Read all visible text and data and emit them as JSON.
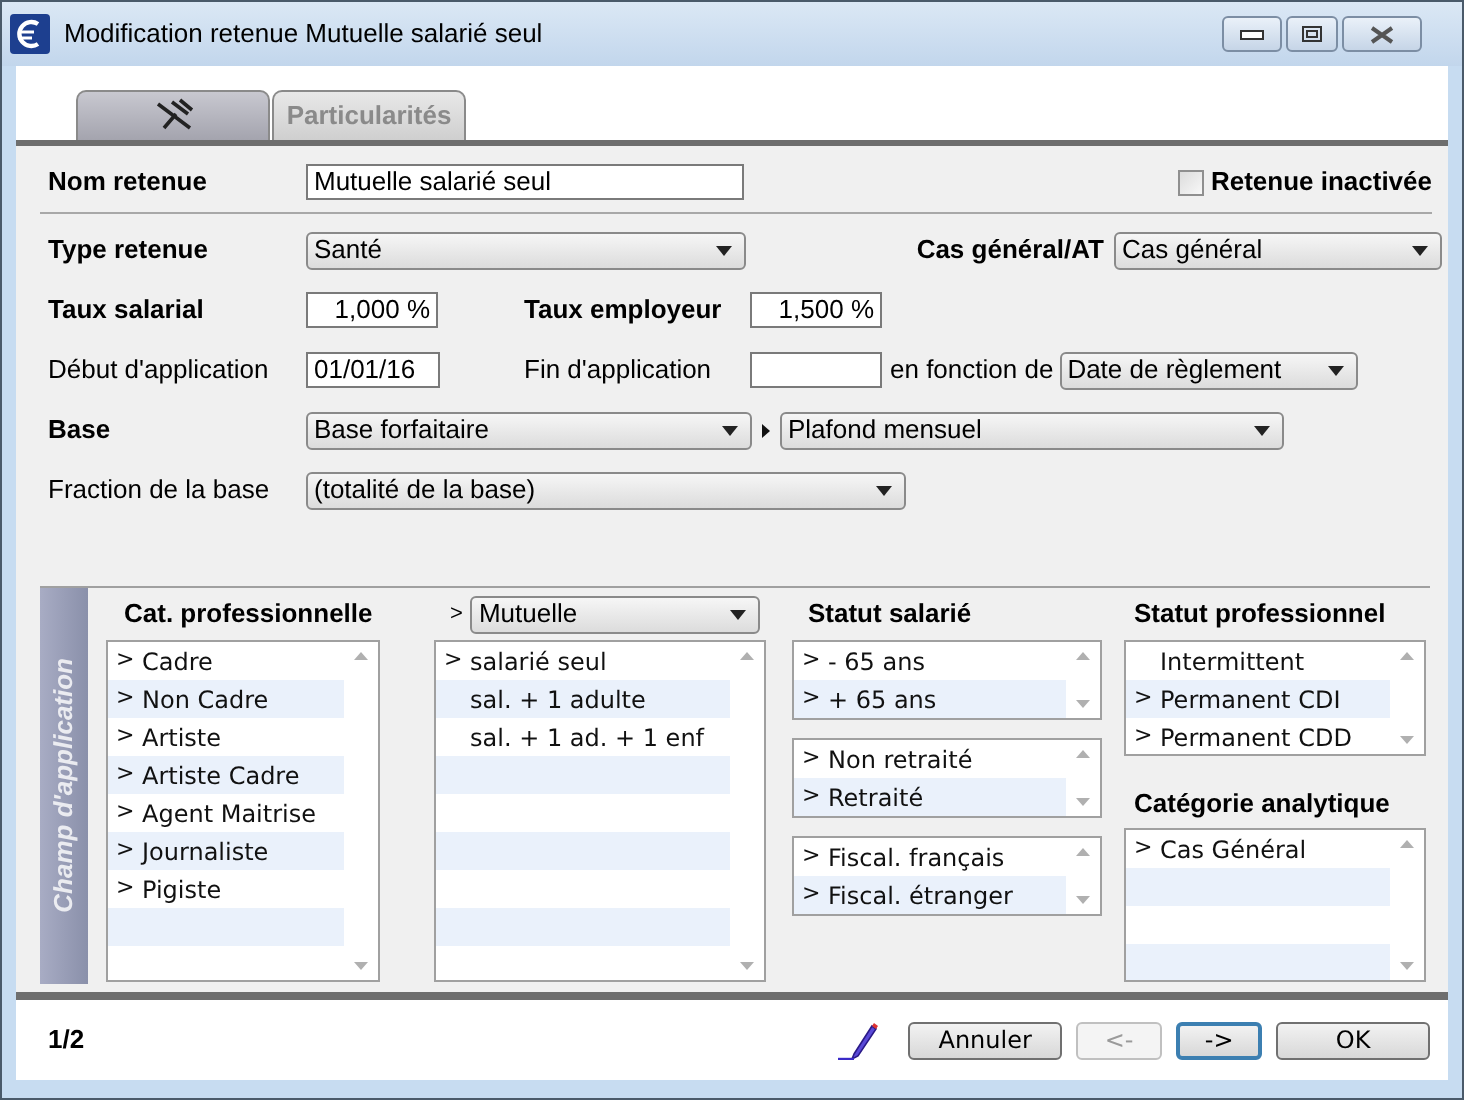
{
  "window": {
    "title": "Modification retenue Mutuelle salarié seul"
  },
  "tabs": [
    {
      "kind": "icon",
      "selected": true
    },
    {
      "kind": "text",
      "label": "Particularités",
      "selected": false
    }
  ],
  "form": {
    "name": {
      "label": "Nom retenue",
      "value": "Mutuelle salarié seul"
    },
    "inactive": {
      "label": "Retenue inactivée",
      "checked": false
    },
    "type": {
      "label": "Type retenue",
      "value": "Santé"
    },
    "case": {
      "label": "Cas général/AT",
      "value": "Cas général"
    },
    "employee_rate": {
      "label": "Taux salarial",
      "value": "1,000 %"
    },
    "employer_rate": {
      "label": "Taux employeur",
      "value": "1,500 %"
    },
    "start": {
      "label": "Début d'application",
      "value": "01/01/16"
    },
    "end": {
      "label": "Fin d'application"
    },
    "depends_on": {
      "label": "en fonction de",
      "value": "Date de règlement"
    },
    "base": {
      "label": "Base",
      "value": "Base forfaitaire",
      "ceiling": "Plafond mensuel"
    },
    "fraction": {
      "label": "Fraction de la base",
      "value": "(totalité de la base)"
    }
  },
  "scope": {
    "title": "Champ d'application",
    "categories": {
      "title": "Cat. professionnelle",
      "items": [
        {
          "mark": ">",
          "label": "Cadre"
        },
        {
          "mark": ">",
          "label": "Non Cadre"
        },
        {
          "mark": ">",
          "label": "Artiste"
        },
        {
          "mark": ">",
          "label": "Artiste Cadre"
        },
        {
          "mark": ">",
          "label": "Agent Maitrise"
        },
        {
          "mark": ">",
          "label": "Journaliste"
        },
        {
          "mark": ">",
          "label": "Pigiste"
        }
      ]
    },
    "mutuelle": {
      "mark": ">",
      "value": "Mutuelle",
      "items": [
        {
          "mark": ">",
          "label": "salarié seul"
        },
        {
          "label": "sal. + 1 adulte"
        },
        {
          "label": "sal. + 1 ad. + 1 enf"
        }
      ]
    },
    "employee_status": {
      "title": "Statut salarié",
      "lists": [
        [
          {
            "mark": ">",
            "label": "- 65 ans"
          },
          {
            "mark": ">",
            "label": "+ 65 ans"
          }
        ],
        [
          {
            "mark": ">",
            "label": "Non retraité"
          },
          {
            "mark": ">",
            "label": "Retraité"
          }
        ],
        [
          {
            "mark": ">",
            "label": "Fiscal. français"
          },
          {
            "mark": ">",
            "label": "Fiscal. étranger"
          }
        ]
      ]
    },
    "professional_status": {
      "title": "Statut professionnel",
      "items": [
        {
          "label": "Intermittent"
        },
        {
          "mark": ">",
          "label": "Permanent CDI"
        },
        {
          "mark": ">",
          "label": "Permanent CDD"
        }
      ]
    },
    "analytic_category": {
      "title": "Catégorie analytique",
      "items": [
        {
          "mark": ">",
          "label": "Cas Général"
        }
      ]
    }
  },
  "footer": {
    "page": "1/2",
    "buttons": [
      {
        "label": "Annuler",
        "disabled": false,
        "default": false
      },
      {
        "label": "<-",
        "disabled": true,
        "default": false
      },
      {
        "label": "->",
        "disabled": false,
        "default": true
      },
      {
        "label": "OK",
        "disabled": false,
        "default": false
      }
    ]
  }
}
